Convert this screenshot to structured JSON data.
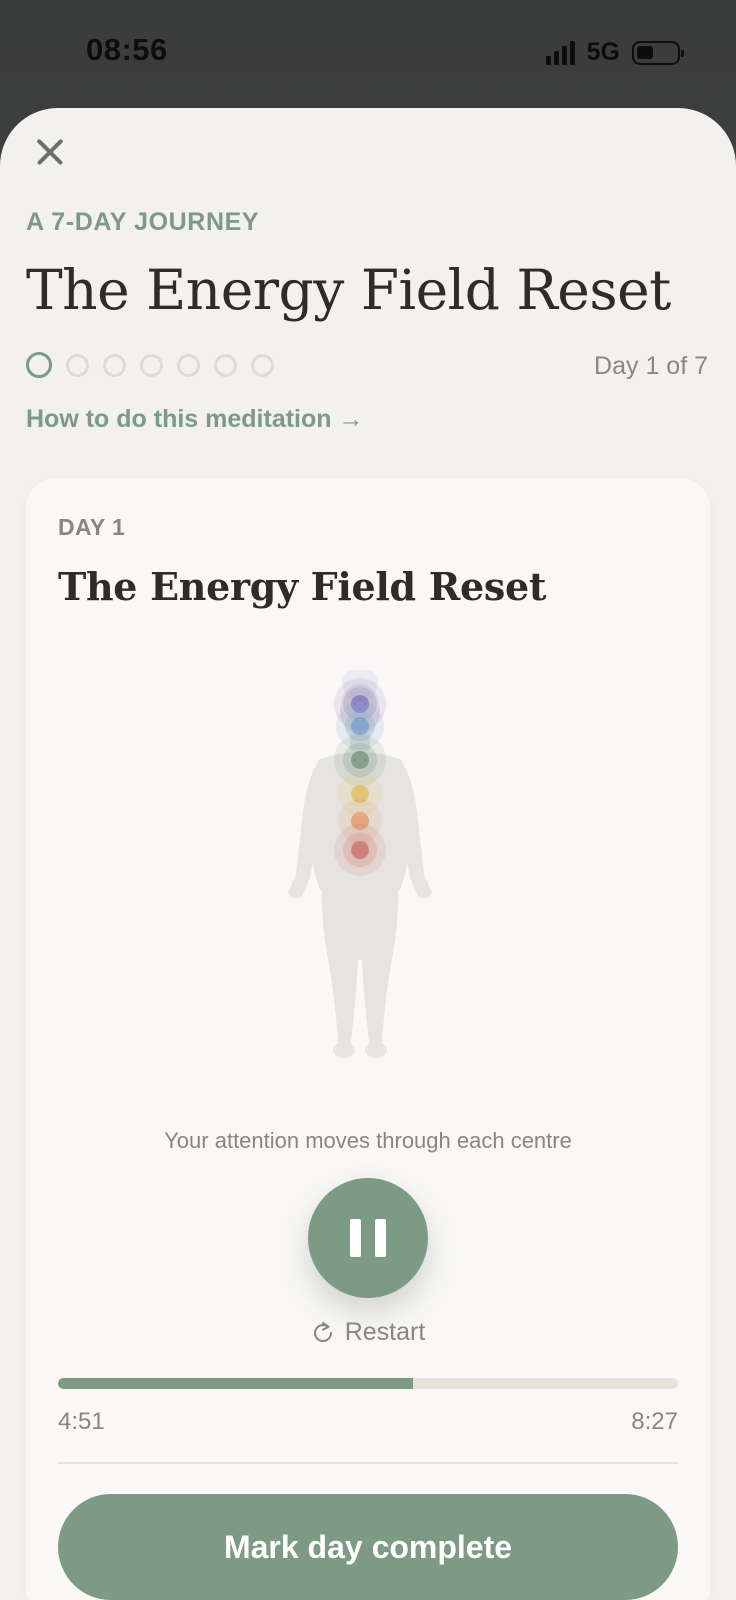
{
  "status_bar": {
    "time": "08:56",
    "network": "5G"
  },
  "header": {
    "eyebrow": "A 7-DAY JOURNEY",
    "title": "The Energy Field Reset",
    "day_counter": "Day 1 of 7",
    "total_days": 7,
    "current_day": 1,
    "howto_link": "How to do this meditation →"
  },
  "card": {
    "day_label": "DAY 1",
    "title": "The Energy Field Reset",
    "caption": "Your attention moves through each centre",
    "restart_label": "Restart",
    "progress_fraction": 0.573,
    "time_elapsed": "4:51",
    "time_total": "8:27",
    "complete_label": "Mark day complete"
  },
  "energy_centres": [
    {
      "name": "crown",
      "color": "#8b7fc0"
    },
    {
      "name": "third-eye",
      "color": "#7fa3c9"
    },
    {
      "name": "heart",
      "color": "#7d9a85"
    },
    {
      "name": "solar-plexus",
      "color": "#e0c070"
    },
    {
      "name": "sacral",
      "color": "#e3a078"
    },
    {
      "name": "root",
      "color": "#cf7a72"
    }
  ],
  "colors": {
    "accent": "#7d9a85",
    "sheet_bg": "#f3f1ed",
    "card_bg": "#f9f8f6",
    "title_text": "#2f2b26"
  }
}
